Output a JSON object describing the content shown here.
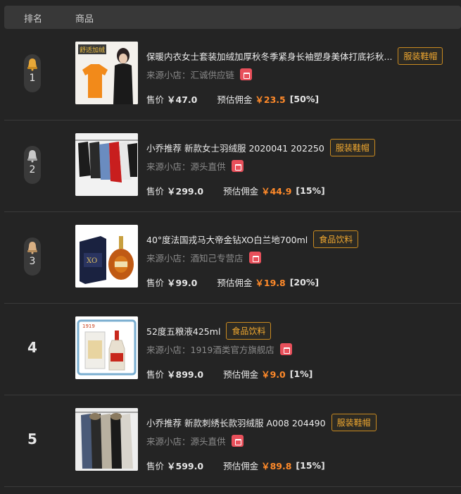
{
  "header": {
    "rank_label": "排名",
    "product_label": "商品"
  },
  "price_label": "售价",
  "commission_label": "预估佣金",
  "shop_prefix": "来源小店：",
  "rows": [
    {
      "rank": "1",
      "title": "保暖内衣女士套装加绒加厚秋冬季紧身长袖塑身美体打底衫秋...",
      "tag": "服装鞋帽",
      "shop": "汇诚供应链",
      "price": "￥47.0",
      "commission": "￥23.5",
      "rate": "[50%]",
      "thumb_text": "舒适加绒"
    },
    {
      "rank": "2",
      "title": "小乔推荐 新款女士羽绒服 2020041 202250",
      "tag": "服装鞋帽",
      "shop": "源头直供",
      "price": "￥299.0",
      "commission": "￥44.9",
      "rate": "[15%]"
    },
    {
      "rank": "3",
      "title": "40°度法国戎马大帝金钻XO白兰地700ml",
      "tag": "食品饮料",
      "shop": "酒知己专营店",
      "price": "￥99.0",
      "commission": "￥19.8",
      "rate": "[20%]",
      "thumb_text": "XO"
    },
    {
      "rank": "4",
      "title": "52度五粮液425ml",
      "tag": "食品饮料",
      "shop": "1919酒类官方旗舰店",
      "price": "￥899.0",
      "commission": "￥9.0",
      "rate": "[1%]",
      "thumb_text": "1919"
    },
    {
      "rank": "5",
      "title": "小乔推荐 新款刺绣长款羽绒服 A008 204490",
      "tag": "服装鞋帽",
      "shop": "源头直供",
      "price": "￥599.0",
      "commission": "￥89.8",
      "rate": "[15%]"
    }
  ],
  "colors": {
    "gold": "#e8a838",
    "silver": "#c8c8c8",
    "bronze": "#d9b084",
    "accent": "#ff8a2a"
  }
}
